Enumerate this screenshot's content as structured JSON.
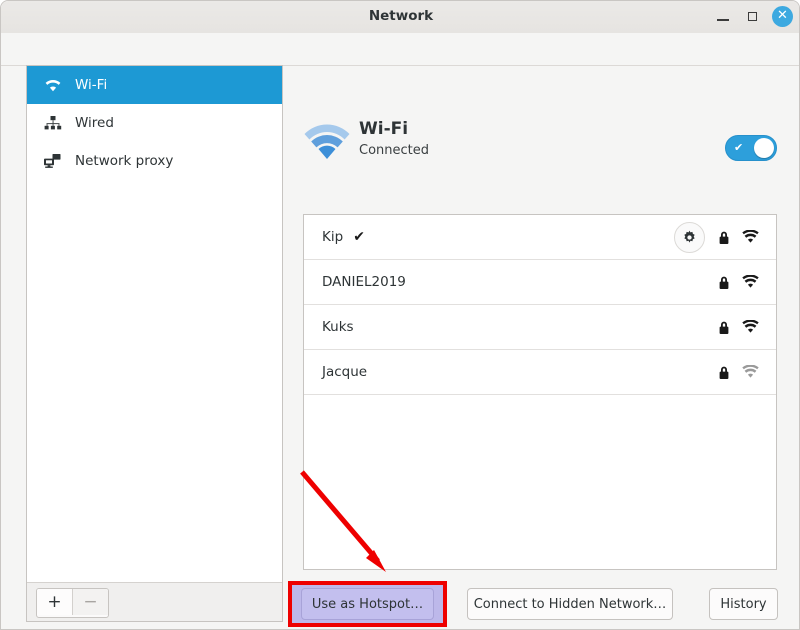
{
  "window": {
    "title": "Network",
    "controls": {
      "minimize": {
        "name": "minimize",
        "glyph": "–"
      },
      "maximize": {
        "name": "maximize",
        "glyph": ""
      },
      "close": {
        "name": "close",
        "glyph": "✕",
        "color": "#3da9e0"
      }
    }
  },
  "sidebar": {
    "items": [
      {
        "label": "Wi-Fi",
        "icon": "wifi-icon",
        "selected": true
      },
      {
        "label": "Wired",
        "icon": "wired-icon",
        "selected": false
      },
      {
        "label": "Network proxy",
        "icon": "proxy-icon",
        "selected": false
      }
    ],
    "toolbar": {
      "add_label": "+",
      "remove_label": "−"
    },
    "selected_color": "#1d99d4"
  },
  "panel": {
    "title": "Wi-Fi",
    "status": "Connected",
    "icon": "wifi-icon",
    "toggle": {
      "state": "on",
      "check_glyph": "✔",
      "color": "#2d9fdb"
    }
  },
  "networks": [
    {
      "ssid": "Kip",
      "connected": true,
      "check_glyph": "✔",
      "has_settings": true,
      "secured": true,
      "signal": "strong"
    },
    {
      "ssid": "DANIEL2019",
      "connected": false,
      "check_glyph": "",
      "has_settings": false,
      "secured": true,
      "signal": "strong"
    },
    {
      "ssid": "Kuks",
      "connected": false,
      "check_glyph": "",
      "has_settings": false,
      "secured": true,
      "signal": "strong"
    },
    {
      "ssid": "Jacque",
      "connected": false,
      "check_glyph": "",
      "has_settings": false,
      "secured": true,
      "signal": "weak"
    }
  ],
  "actions": {
    "hotspot_label": "Use as Hotspot…",
    "hidden_network_label": "Connect to Hidden Network…",
    "history_label": "History"
  },
  "annotation": {
    "color": "#ee0000",
    "highlight_target": "Use as Hotspot…"
  }
}
